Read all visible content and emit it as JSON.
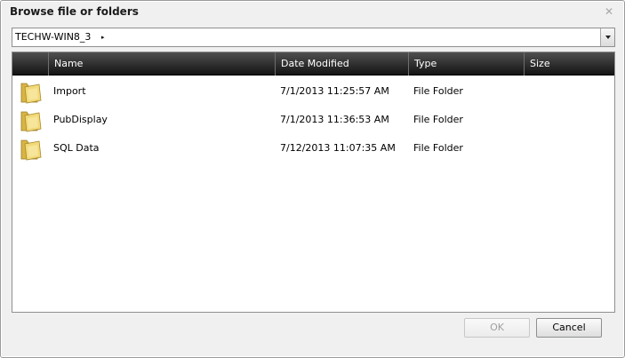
{
  "dialog": {
    "title": "Browse file or folders",
    "close_glyph": "✕"
  },
  "path": {
    "current": "TECHW-WIN8_3",
    "separator": "▸"
  },
  "columns": {
    "name": "Name",
    "date_modified": "Date Modified",
    "type": "Type",
    "size": "Size"
  },
  "rows": [
    {
      "icon": "folder-icon",
      "name": "Import",
      "date_modified": "7/1/2013 11:25:57 AM",
      "type": "File Folder",
      "size": ""
    },
    {
      "icon": "folder-icon",
      "name": "PubDisplay",
      "date_modified": "7/1/2013 11:36:53 AM",
      "type": "File Folder",
      "size": ""
    },
    {
      "icon": "folder-icon",
      "name": "SQL Data",
      "date_modified": "7/12/2013 11:07:35 AM",
      "type": "File Folder",
      "size": ""
    }
  ],
  "buttons": {
    "ok_label": "OK",
    "ok_enabled": false,
    "cancel_label": "Cancel"
  },
  "colors": {
    "header_bg": "#141414",
    "folder": "#e8c95c"
  }
}
